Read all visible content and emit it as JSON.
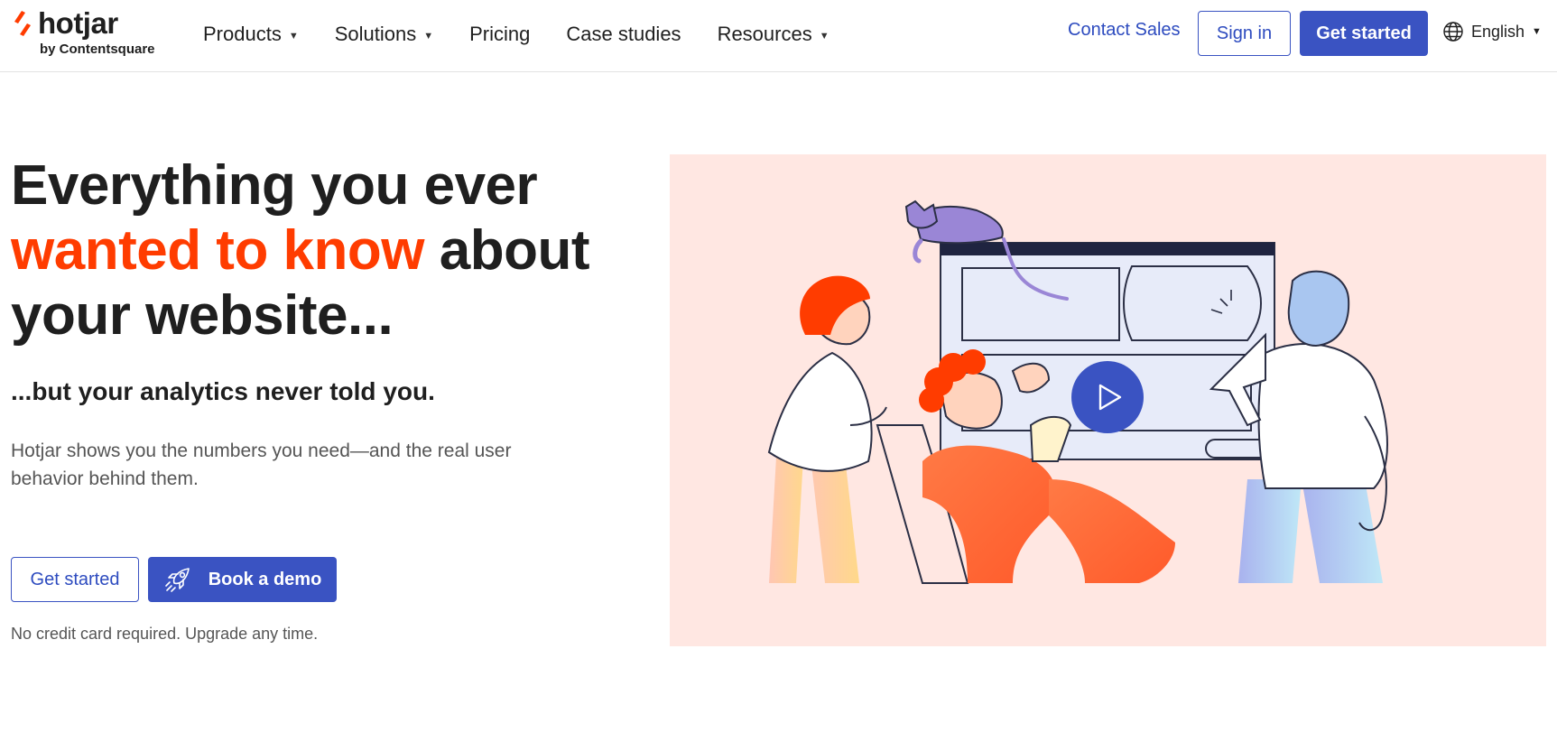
{
  "brand": {
    "name": "hotjar",
    "tagline": "by Contentsquare",
    "accent_color": "#ff3c00",
    "primary_color": "#3a53c2"
  },
  "nav": {
    "items": [
      {
        "label": "Products",
        "has_dropdown": true
      },
      {
        "label": "Solutions",
        "has_dropdown": true
      },
      {
        "label": "Pricing",
        "has_dropdown": false
      },
      {
        "label": "Case studies",
        "has_dropdown": false
      },
      {
        "label": "Resources",
        "has_dropdown": true
      }
    ],
    "chevron": "⌄"
  },
  "header_actions": {
    "contact_sales": "Contact Sales",
    "sign_in": "Sign in",
    "get_started": "Get started",
    "language": "English",
    "language_icon": "globe-icon"
  },
  "hero": {
    "title_part1": "Everything you ever ",
    "title_accent": "wanted to know",
    "title_part2": " about your website...",
    "subtitle": "...but your analytics never told you.",
    "description": "Hotjar shows you the numbers you need—and the real user behavior behind them.",
    "cta_primary": "Get started",
    "cta_demo": "Book a demo",
    "cta_demo_icon": "rocket-icon",
    "note": "No credit card required. Upgrade any time."
  },
  "illustration": {
    "background": "#ffe7e2",
    "play_icon": "play-icon"
  }
}
